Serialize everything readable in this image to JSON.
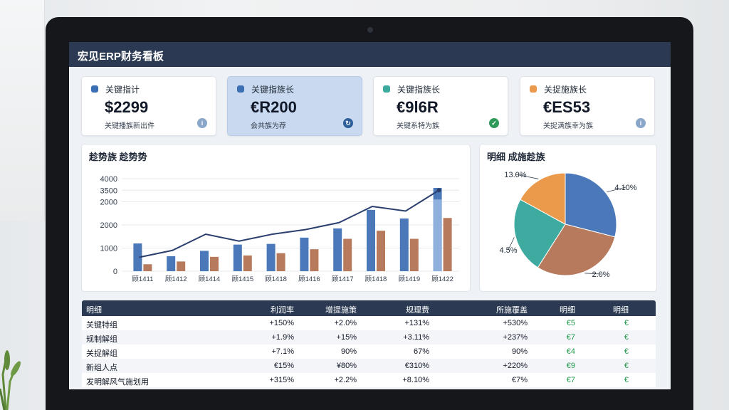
{
  "app": {
    "title": "宏见ERP财务看板"
  },
  "colors": {
    "blue": "#4a78b8",
    "brown": "#b77a5c",
    "navy": "#2b3a52",
    "teal": "#3eaaa0",
    "orange": "#ea9a4a",
    "green": "#1f9a4a",
    "line": "#2b3f6e"
  },
  "kpis": [
    {
      "label": "关键指计",
      "value": "$2299",
      "sub": "关键播族新出件",
      "dot_color": "#3d6fb5",
      "icon_color": "#8aa6c8",
      "icon": "info-icon",
      "active": false
    },
    {
      "label": "关键指族长",
      "value": "€R200",
      "sub": "会共族为荐",
      "dot_color": "#3d6fb5",
      "icon_color": "#2f5f9a",
      "icon": "refresh-icon",
      "active": true
    },
    {
      "label": "关键指族长",
      "value": "€9l6R",
      "sub": "关键系特为族",
      "dot_color": "#3eaaa0",
      "icon_color": "#2f9a5a",
      "icon": "check-icon",
      "active": false
    },
    {
      "label": "关捉施族长",
      "value": "€ES53",
      "sub": "关捉满族幸为族",
      "dot_color": "#ea9a4a",
      "icon_color": "#8aa6c8",
      "icon": "info-icon",
      "active": false
    }
  ],
  "trend_panel": {
    "title": "趁势族  趁势势"
  },
  "pie_panel": {
    "title": "明细  成施趁族"
  },
  "chart_data": [
    {
      "type": "bar",
      "title": "趁势族  趁势势",
      "categories": [
        "顾1411",
        "顾1412",
        "顾1414",
        "顾1415",
        "顾1418",
        "顾1416",
        "顾1417",
        "顾1418",
        "顾1419",
        "顾1422"
      ],
      "ylim": [
        0,
        4000
      ],
      "yticks": [
        0,
        1000,
        2000,
        3000,
        3500,
        4000
      ],
      "ytick_labels": [
        "0",
        "1000",
        "2000",
        "2000",
        "3500",
        "4000"
      ],
      "series": [
        {
          "values": [
            1200,
            650,
            880,
            1150,
            1180,
            1450,
            1850,
            2650,
            2280,
            2880
          ],
          "color": "#4a78b8"
        },
        {
          "values": [
            300,
            420,
            620,
            680,
            780,
            950,
            1400,
            1750,
            1400,
            2300
          ],
          "color": "#b77a5c"
        },
        {
          "values": [
            600,
            900,
            1600,
            1300,
            1600,
            1800,
            2100,
            2800,
            2600,
            3500
          ],
          "color": "#2b3f6e",
          "kind": "line"
        }
      ],
      "extra_bars": [
        {
          "category_index": 9,
          "value": 3100,
          "color": "#8fb0dc"
        }
      ],
      "last_bar_value": 3600,
      "grid": true
    },
    {
      "type": "pie",
      "title": "明细  成施趁族",
      "slices": [
        {
          "label": "4.10%",
          "value": 29,
          "color": "#4a78b8"
        },
        {
          "label": "2.0%",
          "value": 30,
          "color": "#b77a5c"
        },
        {
          "label": "4.5%",
          "value": 24,
          "color": "#3eaaa0"
        },
        {
          "label": "13.0%",
          "value": 17,
          "color": "#ea9a4a"
        }
      ]
    }
  ],
  "table": {
    "headers": [
      "明细",
      "利润率",
      "增提施策",
      "规理费",
      "所施覆盖",
      "明细",
      "明细"
    ],
    "rows": [
      {
        "cells": [
          "关键特组",
          "+150%",
          "+2.0%",
          "+131%",
          "+530%",
          "€5",
          "€"
        ],
        "green": [
          false,
          false,
          false,
          false,
          false,
          true,
          true
        ]
      },
      {
        "cells": [
          "规制解组",
          "+1.9%",
          "+15%",
          "+3.11%",
          "+237%",
          "€7",
          "€"
        ],
        "green": [
          false,
          false,
          false,
          false,
          false,
          true,
          true
        ]
      },
      {
        "cells": [
          "关捉解组",
          "+7.1%",
          "90%",
          "67%",
          "90%",
          "€4",
          "€"
        ],
        "green": [
          false,
          false,
          false,
          false,
          false,
          true,
          true
        ]
      },
      {
        "cells": [
          "新组人点",
          "€15%",
          "¥80%",
          "€310%",
          "+220%",
          "€9",
          "€"
        ],
        "green": [
          false,
          false,
          false,
          false,
          false,
          true,
          true
        ]
      },
      {
        "cells": [
          "发明解风气施划用",
          "+315%",
          "+2.2%",
          "+8.10%",
          "€7%",
          "€7",
          "€"
        ],
        "green": [
          false,
          false,
          false,
          false,
          false,
          true,
          true
        ]
      }
    ]
  }
}
